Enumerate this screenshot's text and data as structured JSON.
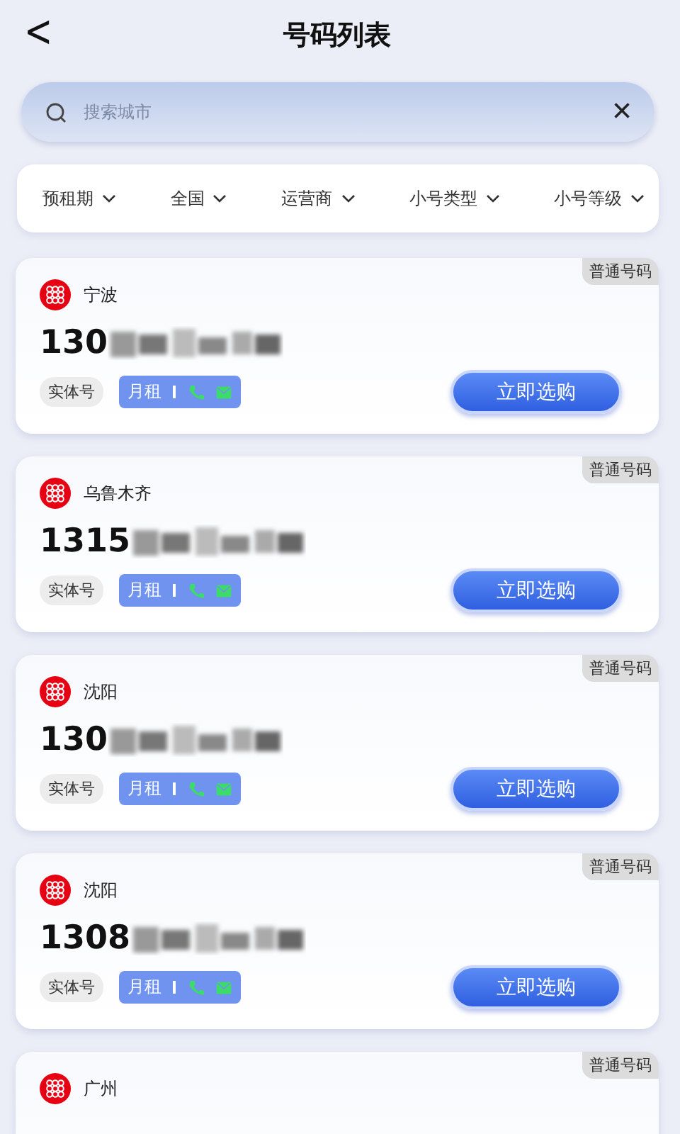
{
  "header": {
    "back": "<",
    "title": "号码列表"
  },
  "search": {
    "placeholder": "搜索城市",
    "clear": "×"
  },
  "filters": [
    {
      "label": "预租期"
    },
    {
      "label": "全国"
    },
    {
      "label": "运营商"
    },
    {
      "label": "小号类型"
    },
    {
      "label": "小号等级"
    }
  ],
  "cards": [
    {
      "city": "宁波",
      "number": "130",
      "badge": "普通号码",
      "tag": "实体号",
      "plan": "月租",
      "button": "立即选购"
    },
    {
      "city": "乌鲁木齐",
      "number": "1315",
      "badge": "普通号码",
      "tag": "实体号",
      "plan": "月租",
      "button": "立即选购"
    },
    {
      "city": "沈阳",
      "number": "130",
      "badge": "普通号码",
      "tag": "实体号",
      "plan": "月租",
      "button": "立即选购"
    },
    {
      "city": "沈阳",
      "number": "1308",
      "badge": "普通号码",
      "tag": "实体号",
      "plan": "月租",
      "button": "立即选购"
    },
    {
      "city": "广州",
      "badge": "普通号码"
    }
  ]
}
